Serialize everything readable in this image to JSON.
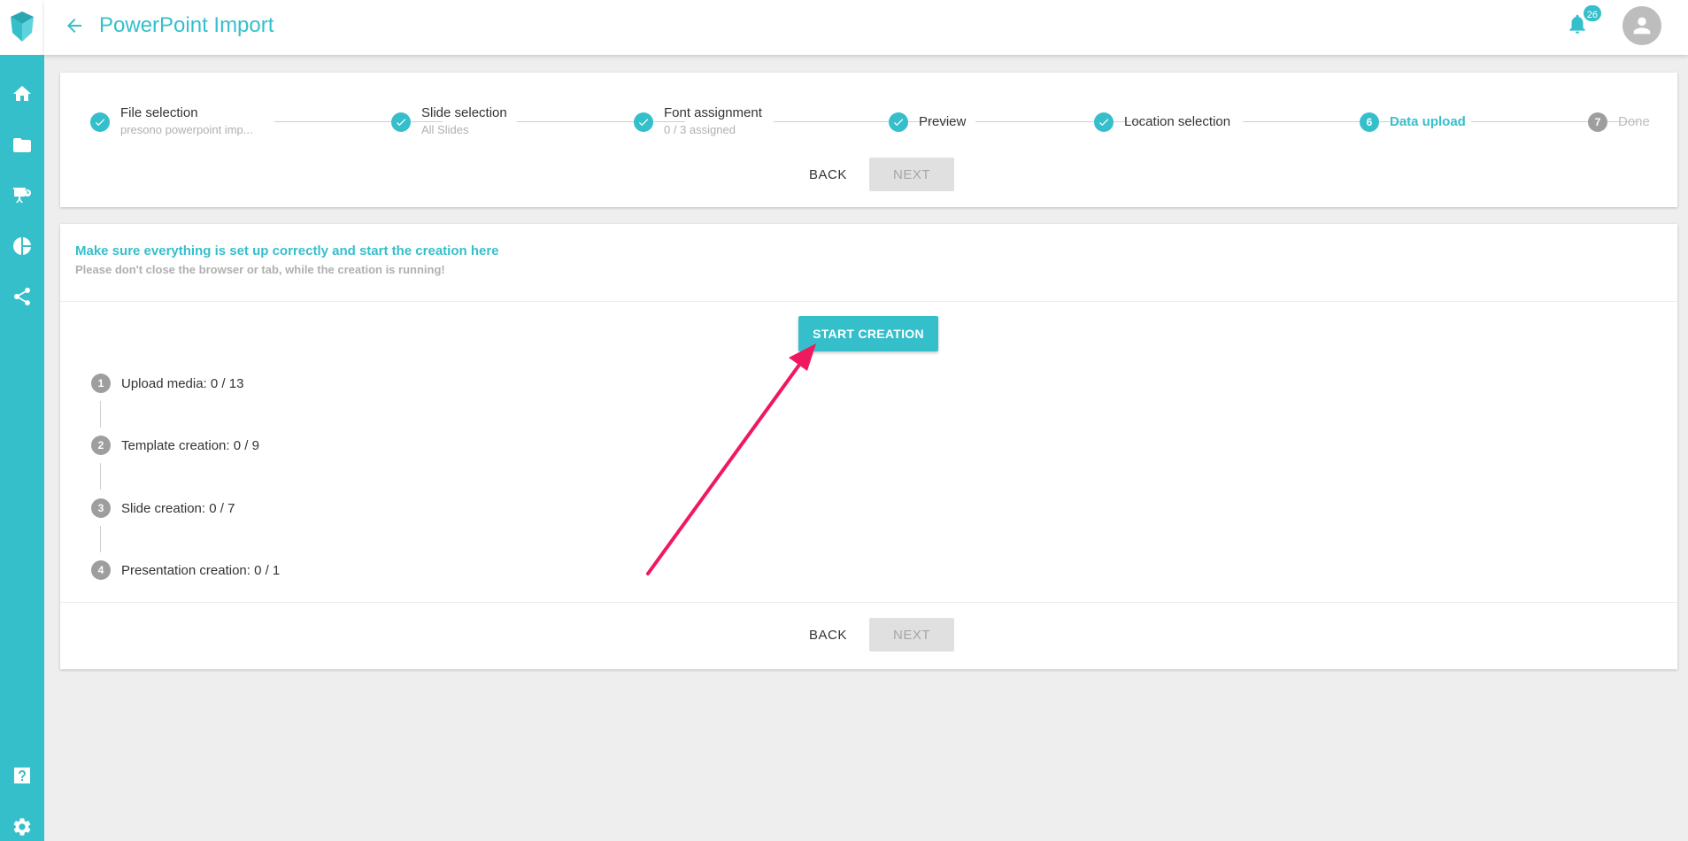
{
  "app": {
    "title": "PowerPoint Import",
    "notification_count": "26"
  },
  "sidebar": {
    "items": [
      {
        "icon": "home-icon"
      },
      {
        "icon": "folder-icon"
      },
      {
        "icon": "presentation-icon"
      },
      {
        "icon": "pie-chart-icon"
      },
      {
        "icon": "share-icon"
      }
    ],
    "bottom": [
      {
        "icon": "help-icon"
      },
      {
        "icon": "gear-icon"
      }
    ]
  },
  "stepper": {
    "steps": [
      {
        "label": "File selection",
        "sub": "presono powerpoint imp...",
        "state": "done"
      },
      {
        "label": "Slide selection",
        "sub": "All Slides",
        "state": "done"
      },
      {
        "label": "Font assignment",
        "sub": "0 / 3 assigned",
        "state": "done"
      },
      {
        "label": "Preview",
        "sub": "",
        "state": "done"
      },
      {
        "label": "Location selection",
        "sub": "",
        "state": "done"
      },
      {
        "label": "Data upload",
        "number": "6",
        "sub": "",
        "state": "active"
      },
      {
        "label": "Done",
        "number": "7",
        "sub": "",
        "state": "pending"
      }
    ],
    "back_label": "BACK",
    "next_label": "NEXT"
  },
  "content": {
    "title": "Make sure everything is set up correctly and start the creation here",
    "subtitle": "Please don't close the browser or tab, while the creation is running!",
    "start_label": "START CREATION",
    "progress": [
      {
        "number": "1",
        "label": "Upload media: 0 / 13"
      },
      {
        "number": "2",
        "label": "Template creation: 0 / 9"
      },
      {
        "number": "3",
        "label": "Slide creation: 0 / 7"
      },
      {
        "number": "4",
        "label": "Presentation creation: 0 / 1"
      }
    ],
    "back_label": "BACK",
    "next_label": "NEXT"
  },
  "colors": {
    "accent": "#35bfcb",
    "annotation_arrow": "#f0185f"
  }
}
